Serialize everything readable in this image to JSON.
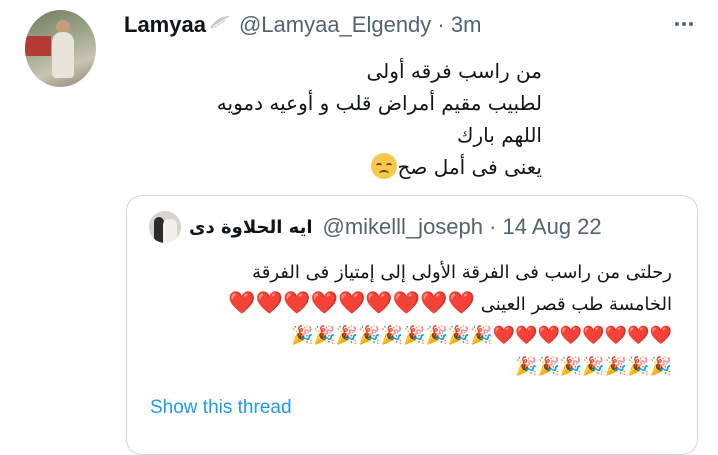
{
  "tweet": {
    "display_name": "Lamyaa",
    "name_emoji": "wing-icon",
    "handle": "@Lamyaa_Elgendy · 3m",
    "lines": [
      "من راسب فرقه أولى",
      "لطبيب مقيم أمراض قلب و أوعيه دمويه",
      "اللهم بارك",
      "يعنى فى أمل صح"
    ],
    "line4_emoji": "disappointed-face-icon"
  },
  "quoted": {
    "display_name": "ايه الحلاوة دى",
    "handle": "@mikelll_joseph · 14 Aug 22",
    "line1": "رحلتى من راسب فى الفرقة الأولى إلى إمتياز فى الفرقة",
    "line2": "الخامسة طب قصر العينى",
    "hearts_line2": "❤️❤️❤️❤️❤️❤️❤️❤️❤️",
    "line3": "🎉🎉🎉🎉🎉🎉🎉🎉🎉❤️❤️❤️❤️❤️❤️❤️❤️",
    "line4": "🎉🎉🎉🎉🎉🎉🎉",
    "show_thread": "Show this thread"
  },
  "colors": {
    "accent": "#1d9bf0",
    "text": "#0f1419",
    "muted": "#536471",
    "border": "#cfd9de"
  }
}
